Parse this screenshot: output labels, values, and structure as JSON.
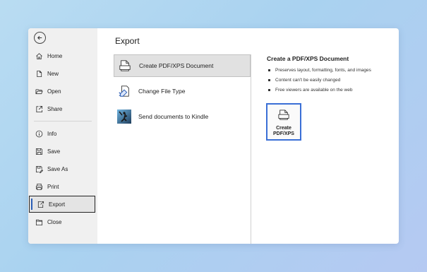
{
  "sidebar": {
    "items": [
      {
        "label": "Home",
        "icon": "home-icon"
      },
      {
        "label": "New",
        "icon": "new-document-icon"
      },
      {
        "label": "Open",
        "icon": "folder-open-icon"
      },
      {
        "label": "Share",
        "icon": "share-icon"
      },
      {
        "label": "Info",
        "icon": "info-icon"
      },
      {
        "label": "Save",
        "icon": "save-icon"
      },
      {
        "label": "Save As",
        "icon": "save-as-icon"
      },
      {
        "label": "Print",
        "icon": "printer-icon"
      },
      {
        "label": "Export",
        "icon": "export-icon",
        "selected": true
      },
      {
        "label": "Close",
        "icon": "close-folder-icon"
      }
    ],
    "accent_color": "#2b5eb6"
  },
  "main": {
    "title": "Export",
    "options": [
      {
        "label": "Create PDF/XPS Document",
        "icon": "pdf-document-icon",
        "selected": true
      },
      {
        "label": "Change File Type",
        "icon": "change-file-type-icon"
      },
      {
        "label": "Send documents to Kindle",
        "icon": "kindle-icon"
      }
    ]
  },
  "detail": {
    "title": "Create a PDF/XPS Document",
    "bullets": [
      "Preserves layout, formatting, fonts, and images",
      "Content can't be easily changed",
      "Free viewers are available on the web"
    ],
    "button_line1": "Create",
    "button_line2": "PDF/XPS",
    "button_border_color": "#3a6fd6"
  }
}
